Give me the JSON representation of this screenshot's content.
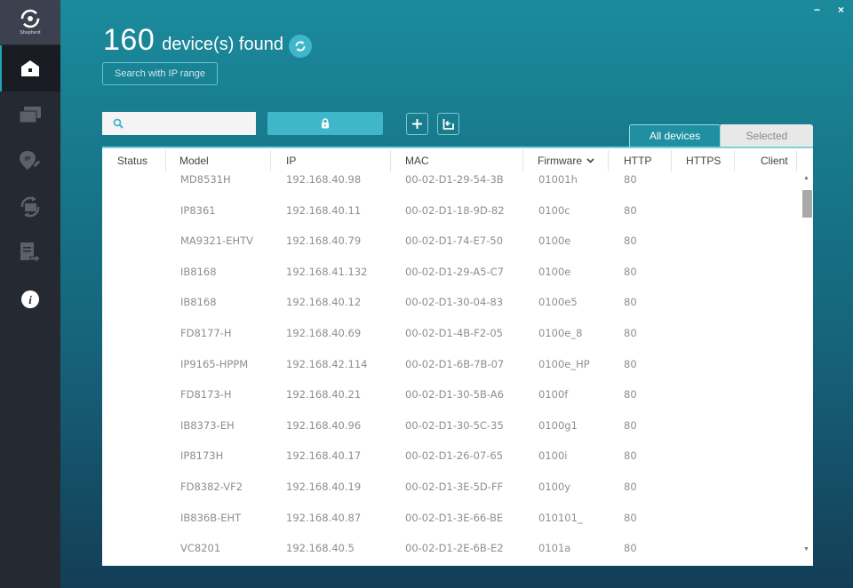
{
  "app": {
    "name": "Shepherd",
    "window_controls": {
      "minimize": "−",
      "close": "×"
    }
  },
  "sidebar": {
    "items": [
      {
        "name": "home",
        "icon": "home-icon",
        "active": true
      },
      {
        "name": "devices",
        "icon": "devices-icon",
        "active": false
      },
      {
        "name": "ip-config",
        "icon": "ip-location-icon",
        "active": false
      },
      {
        "name": "firmware-upgrade",
        "icon": "sync-device-icon",
        "active": false
      },
      {
        "name": "export-report",
        "icon": "document-export-icon",
        "active": false
      },
      {
        "name": "about",
        "icon": "info-icon",
        "active": false
      }
    ]
  },
  "header": {
    "count": "160",
    "label": "device(s) found",
    "ip_range_button": "Search with IP range"
  },
  "toolbar": {
    "search_placeholder": "",
    "search_value": ""
  },
  "tabs": [
    {
      "label": "All devices",
      "active": true
    },
    {
      "label": "Selected",
      "active": false
    }
  ],
  "table": {
    "columns": [
      "Status",
      "Model",
      "IP",
      "MAC",
      "Firmware",
      "HTTP",
      "HTTPS",
      "Client"
    ],
    "sort_column": "Firmware",
    "rows": [
      {
        "status": "",
        "model": "MD8531H",
        "ip": "192.168.40.98",
        "mac": "00-02-D1-29-54-3B",
        "firmware": "01001h",
        "http": "80",
        "https": "",
        "client": ""
      },
      {
        "status": "",
        "model": "IP8361",
        "ip": "192.168.40.11",
        "mac": "00-02-D1-18-9D-82",
        "firmware": "0100c",
        "http": "80",
        "https": "",
        "client": ""
      },
      {
        "status": "",
        "model": "MA9321-EHTV",
        "ip": "192.168.40.79",
        "mac": "00-02-D1-74-E7-50",
        "firmware": "0100e",
        "http": "80",
        "https": "",
        "client": ""
      },
      {
        "status": "",
        "model": "IB8168",
        "ip": "192.168.41.132",
        "mac": "00-02-D1-29-A5-C7",
        "firmware": "0100e",
        "http": "80",
        "https": "",
        "client": ""
      },
      {
        "status": "",
        "model": "IB8168",
        "ip": "192.168.40.12",
        "mac": "00-02-D1-30-04-83",
        "firmware": "0100e5",
        "http": "80",
        "https": "",
        "client": ""
      },
      {
        "status": "",
        "model": "FD8177-H",
        "ip": "192.168.40.69",
        "mac": "00-02-D1-4B-F2-05",
        "firmware": "0100e_8",
        "http": "80",
        "https": "",
        "client": ""
      },
      {
        "status": "",
        "model": "IP9165-HPPM",
        "ip": "192.168.42.114",
        "mac": "00-02-D1-6B-7B-07",
        "firmware": "0100e_HP",
        "http": "80",
        "https": "",
        "client": ""
      },
      {
        "status": "",
        "model": "FD8173-H",
        "ip": "192.168.40.21",
        "mac": "00-02-D1-30-5B-A6",
        "firmware": "0100f",
        "http": "80",
        "https": "",
        "client": ""
      },
      {
        "status": "",
        "model": "IB8373-EH",
        "ip": "192.168.40.96",
        "mac": "00-02-D1-30-5C-35",
        "firmware": "0100g1",
        "http": "80",
        "https": "",
        "client": ""
      },
      {
        "status": "",
        "model": "IP8173H",
        "ip": "192.168.40.17",
        "mac": "00-02-D1-26-07-65",
        "firmware": "0100i",
        "http": "80",
        "https": "",
        "client": ""
      },
      {
        "status": "",
        "model": "FD8382-VF2",
        "ip": "192.168.40.19",
        "mac": "00-02-D1-3E-5D-FF",
        "firmware": "0100y",
        "http": "80",
        "https": "",
        "client": ""
      },
      {
        "status": "",
        "model": "IB836B-EHT",
        "ip": "192.168.40.87",
        "mac": "00-02-D1-3E-66-BE",
        "firmware": "010101_",
        "http": "80",
        "https": "",
        "client": ""
      },
      {
        "status": "",
        "model": "VC8201",
        "ip": "192.168.40.5",
        "mac": "00-02-D1-2E-6B-E2",
        "firmware": "0101a",
        "http": "80",
        "https": "",
        "client": ""
      }
    ]
  },
  "colors": {
    "accent": "#3fb6ca",
    "sidebar": "#252932",
    "sidebar_active": "#191c23"
  }
}
